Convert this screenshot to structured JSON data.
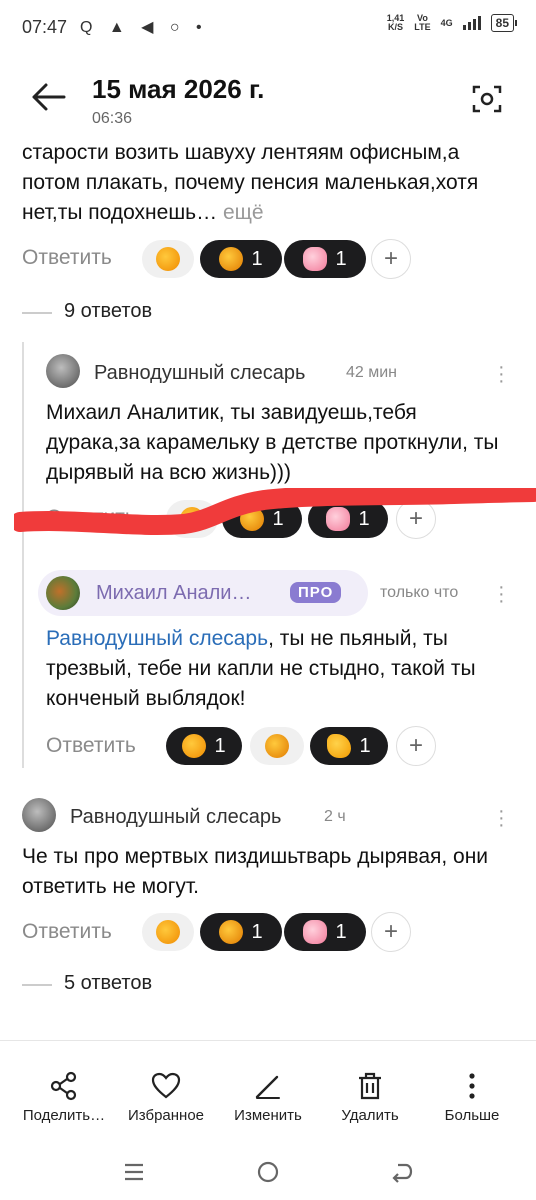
{
  "status_bar": {
    "time": "07:47",
    "icons": "Q ▲ ◀ ○ •",
    "speed_top": "1,41",
    "speed_bottom": "K/S",
    "volte_top": "Vo",
    "volte_bottom": "LTE",
    "network": "4G",
    "battery": "85"
  },
  "header": {
    "title": "15 мая 2026 г.",
    "subtitle": "06:36"
  },
  "comments": [
    {
      "text": "старости возить шавуху лентяям офисным,а потом плакать, почему пенсия маленькая,хотя нет,ты подохнешь…",
      "more_label": "ещё",
      "reply_label": "Ответить",
      "reactions": [
        {
          "type": "like",
          "count": ""
        },
        {
          "type": "dislike",
          "count": "1"
        },
        {
          "type": "pig",
          "count": "1"
        }
      ],
      "answers_label": "9 ответов"
    },
    {
      "author": "Равнодушный слесарь",
      "time": "42 мин",
      "text": "Михаил Аналитик, ты завидуешь,тебя дурака,за карамельку в детстве проткнули, ты дырявый на всю жизнь)))",
      "reply_label": "Ответить",
      "reactions": [
        {
          "type": "like",
          "count": ""
        },
        {
          "type": "dislike",
          "count": "1"
        },
        {
          "type": "pig",
          "count": "1"
        }
      ]
    },
    {
      "author": "Михаил Анали…",
      "badge": "ПРО",
      "time": "только что",
      "mention": "Равнодушный слесарь",
      "text": ", ты не пьяный, ты трезвый, тебе ни капли не стыдно, такой ты конченый выблядок!",
      "reply_label": "Ответить",
      "reactions": [
        {
          "type": "like",
          "count": "1"
        },
        {
          "type": "dislike",
          "count": ""
        },
        {
          "type": "arm",
          "count": "1"
        }
      ]
    },
    {
      "author": "Равнодушный слесарь",
      "time": "2 ч",
      "text": "Че ты про мертвых пиздишьтварь дырявая, они ответить не могут.",
      "reply_label": "Ответить",
      "reactions": [
        {
          "type": "like",
          "count": ""
        },
        {
          "type": "dislike",
          "count": "1"
        },
        {
          "type": "pig",
          "count": "1"
        }
      ],
      "answers_label": "5 ответов"
    }
  ],
  "toolbar": {
    "share": "Поделить…",
    "favorite": "Избранное",
    "edit": "Изменить",
    "delete": "Удалить",
    "more": "Больше"
  },
  "colors": {
    "accent_link": "#2a6db8",
    "pro_badge": "#8a7bd1",
    "annotation_red": "#f03b3b"
  }
}
